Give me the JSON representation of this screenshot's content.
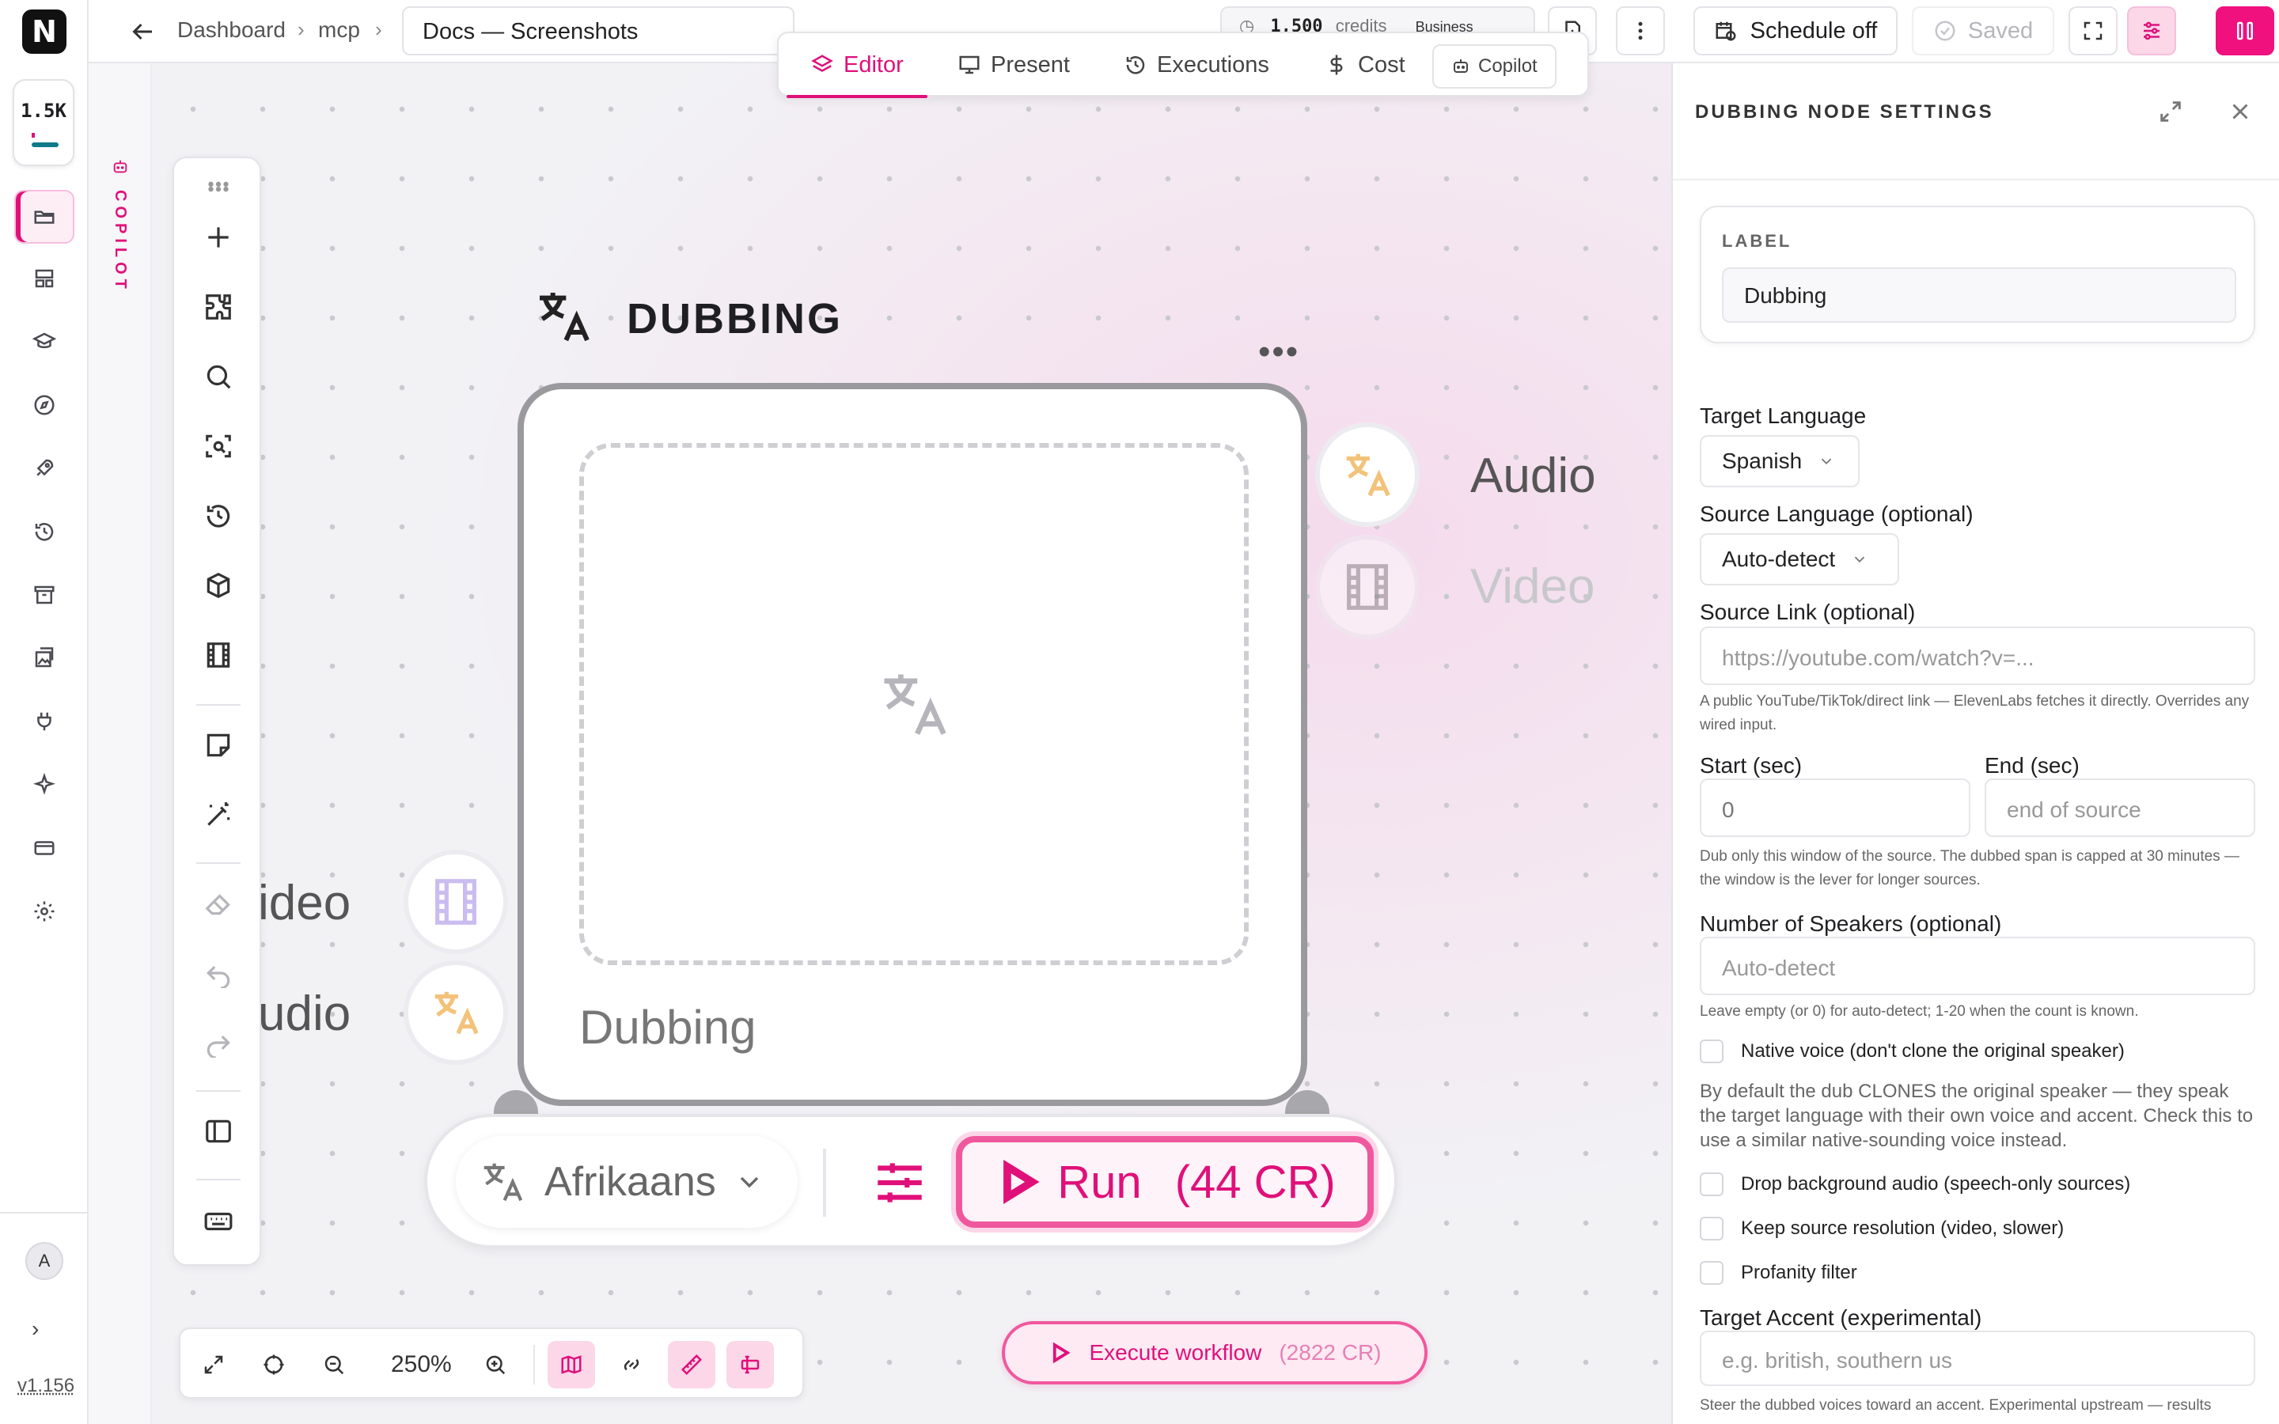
{
  "rail": {
    "logo": "N",
    "credits_short": "1.5K",
    "avatar": "A",
    "version": "v1.156",
    "icons": [
      "folder-icon",
      "layout-icon",
      "graduation-cap-icon",
      "compass-icon",
      "rocket-icon",
      "history-icon",
      "archive-icon",
      "gallery-icon",
      "plug-icon",
      "sparkles-icon",
      "credit-card-icon",
      "gear-icon"
    ]
  },
  "copilot_strip": {
    "label": "COPILOT"
  },
  "topbar": {
    "breadcrumbs": [
      "Dashboard",
      "mcp"
    ],
    "doc_title": "Docs — Screenshots",
    "credits_text": "1,500",
    "credits_unit": "credits",
    "plan": "Business",
    "schedule_label": "Schedule off",
    "saved_label": "Saved"
  },
  "mode_tabs": {
    "editor": "Editor",
    "present": "Present",
    "executions": "Executions",
    "cost": "Cost",
    "copilot": "Copilot"
  },
  "node": {
    "title": "DUBBING",
    "label": "Dubbing",
    "outputs": {
      "audio": "Audio",
      "video": "Video"
    },
    "inputs": {
      "video": "ideo",
      "audio": "udio"
    },
    "language": "Afrikaans",
    "run_label": "Run",
    "run_cost": "(44 CR)"
  },
  "zoom_bar": {
    "zoom_level": "250%"
  },
  "execute": {
    "label": "Execute workflow",
    "cost": "(2822 CR)"
  },
  "panel": {
    "title": "DUBBING NODE SETTINGS",
    "label_caption": "LABEL",
    "label_value": "Dubbing",
    "target_language_label": "Target Language",
    "target_language_value": "Spanish",
    "source_language_label": "Source Language (optional)",
    "source_language_value": "Auto-detect",
    "source_link_label": "Source Link (optional)",
    "source_link_placeholder": "https://youtube.com/watch?v=...",
    "source_link_help": "A public YouTube/TikTok/direct link — ElevenLabs fetches it directly. Overrides any wired input.",
    "start_label": "Start (sec)",
    "start_value": "0",
    "end_label": "End (sec)",
    "end_placeholder": "end of source",
    "window_help": "Dub only this window of the source. The dubbed span is capped at 30 minutes — the window is the lever for longer sources.",
    "speakers_label": "Number of Speakers (optional)",
    "speakers_placeholder": "Auto-detect",
    "speakers_help": "Leave empty (or 0) for auto-detect; 1-20 when the count is known.",
    "native_voice_label": "Native voice (don't clone the original speaker)",
    "native_voice_desc": "By default the dub CLONES the original speaker — they speak the target language with their own voice and accent. Check this to use a similar native-sounding voice instead.",
    "drop_bg_label": "Drop background audio (speech-only sources)",
    "keep_res_label": "Keep source resolution (video, slower)",
    "profanity_label": "Profanity filter",
    "accent_label": "Target Accent (experimental)",
    "accent_placeholder": "e.g. british, southern us",
    "accent_help": "Steer the dubbed voices toward an accent. Experimental upstream — results"
  },
  "colors": {
    "accent": "#e0107a",
    "accent_soft": "#fbd7e8"
  }
}
